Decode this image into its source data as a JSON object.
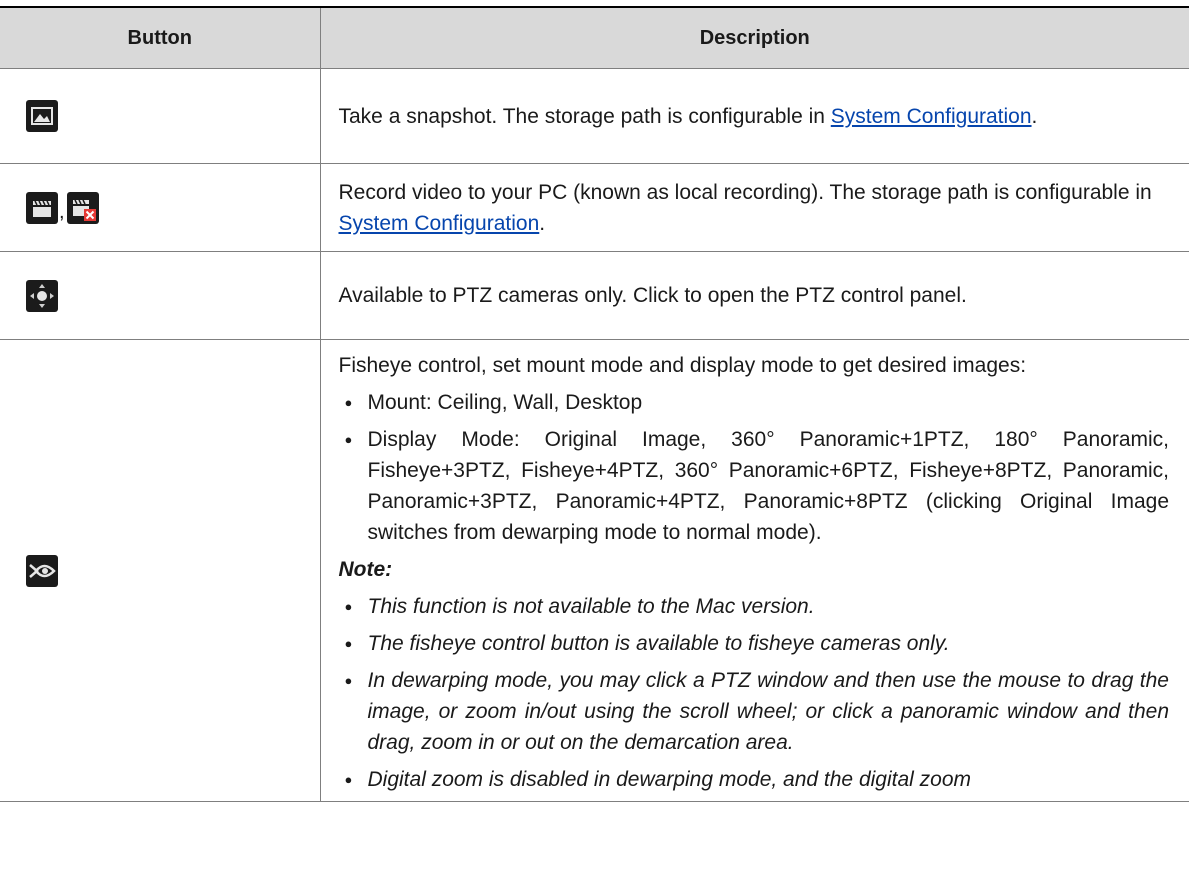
{
  "header": {
    "col_button": "Button",
    "col_description": "Description"
  },
  "rows": [
    {
      "icons": [
        "snapshot-icon"
      ],
      "text_before": "Take a snapshot. The storage path is configurable in ",
      "link": "System Configuration",
      "text_after": "."
    },
    {
      "icons": [
        "record-icon",
        "stop-record-icon"
      ],
      "separator": ",",
      "text_before": "Record video to your PC (known as local recording). The storage path is configurable in ",
      "link": "System Configuration",
      "text_after": "."
    },
    {
      "icons": [
        "ptz-icon"
      ],
      "text": "Available to PTZ cameras only. Click to open the PTZ control panel."
    },
    {
      "icons": [
        "fisheye-icon"
      ],
      "intro": "Fisheye control, set mount mode and display mode to get desired images:",
      "bullets": [
        "Mount: Ceiling, Wall, Desktop",
        "Display Mode: Original Image, 360° Panoramic+1PTZ, 180° Panoramic, Fisheye+3PTZ, Fisheye+4PTZ, 360° Panoramic+6PTZ, Fisheye+8PTZ, Panoramic, Panoramic+3PTZ, Panoramic+4PTZ, Panoramic+8PTZ (clicking Original Image switches from dewarping mode to normal mode)."
      ],
      "note_label": "Note:",
      "notes": [
        "This function is not available to the Mac version.",
        "The fisheye control button is available to fisheye cameras only.",
        "In dewarping mode, you may click a PTZ window and then use the mouse to drag the image, or zoom in/out using the scroll wheel; or click a panoramic window and then drag, zoom in or out on the demarcation area.",
        "Digital zoom is disabled in dewarping mode, and the digital zoom"
      ]
    }
  ]
}
